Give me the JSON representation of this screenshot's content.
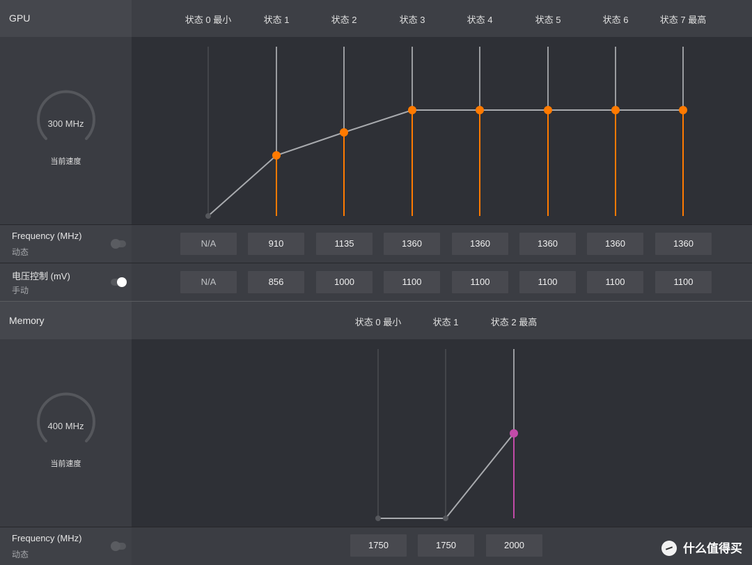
{
  "gpu": {
    "title": "GPU",
    "gauge_value": "300 MHz",
    "gauge_caption": "当前速度",
    "states": [
      "状态 0 最小",
      "状态 1",
      "状态 2",
      "状态 3",
      "状态 4",
      "状态 5",
      "状态 6",
      "状态 7 最高"
    ],
    "frequency_row": {
      "title": "Frequency (MHz)",
      "mode": "动态",
      "toggle_on": false,
      "values": [
        "N/A",
        "910",
        "1135",
        "1360",
        "1360",
        "1360",
        "1360",
        "1360"
      ]
    },
    "voltage_row": {
      "title": "电压控制 (mV)",
      "mode": "手动",
      "toggle_on": true,
      "values": [
        "N/A",
        "856",
        "1000",
        "1100",
        "1100",
        "1100",
        "1100",
        "1100"
      ]
    },
    "curve": {
      "values": [
        null,
        910,
        1135,
        1360,
        1360,
        1360,
        1360,
        1360
      ],
      "accent": "#ff7a00"
    }
  },
  "memory": {
    "title": "Memory",
    "gauge_value": "400 MHz",
    "gauge_caption": "当前速度",
    "states": [
      "状态 0 最小",
      "状态 1",
      "状态 2 最高"
    ],
    "frequency_row": {
      "title": "Frequency (MHz)",
      "mode": "动态",
      "toggle_on": false,
      "values": [
        "1750",
        "1750",
        "2000"
      ]
    },
    "curve": {
      "accent": "#c24ba8"
    }
  },
  "watermark": {
    "text": "什么值得买"
  }
}
